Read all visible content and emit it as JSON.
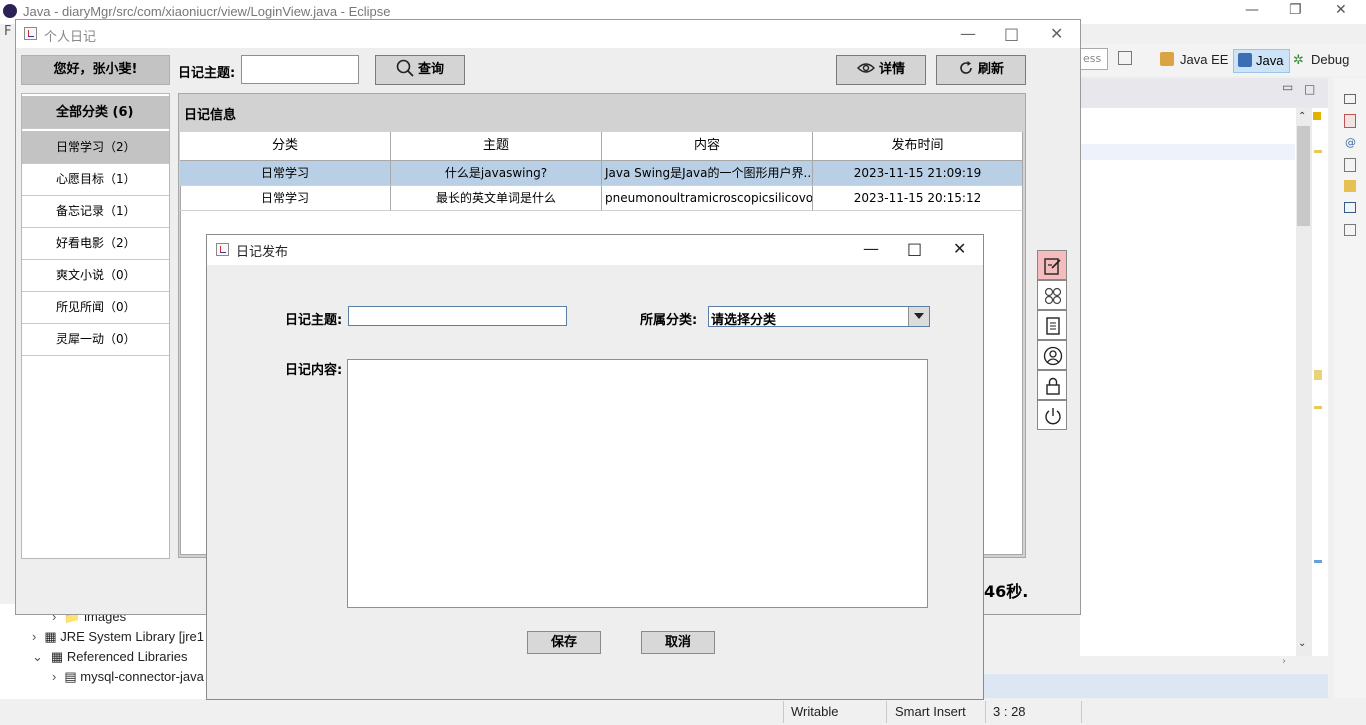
{
  "eclipse": {
    "title": "Java - diaryMgr/src/com/xiaoniucr/view/LoginView.java - Eclipse",
    "menu_partial": "F",
    "search_partial": "ess",
    "perspectives": [
      "Java EE",
      "Java",
      "Debug"
    ],
    "package_tree": [
      {
        "label": "images",
        "indent": 2
      },
      {
        "label": "JRE System Library [jre1",
        "indent": 1
      },
      {
        "label": "Referenced Libraries",
        "indent": 1
      },
      {
        "label": "mysql-connector-java",
        "indent": 2
      }
    ],
    "status": {
      "writable": "Writable",
      "insert_mode": "Smart Insert",
      "position": "3 : 28"
    }
  },
  "main_window": {
    "title": "个人日记",
    "greeting": "您好，张小斐!",
    "search_label": "日记主题:",
    "search_value": "",
    "query_button": "查询",
    "detail_button": "详情",
    "refresh_button": "刷新",
    "categories": [
      {
        "label": "全部分类 (6)",
        "selected": true
      },
      {
        "label": "日常学习（2）",
        "selected": true
      },
      {
        "label": "心愿目标（1）"
      },
      {
        "label": "备忘记录（1）"
      },
      {
        "label": "好看电影（2）"
      },
      {
        "label": "爽文小说（0）"
      },
      {
        "label": "所见所闻（0）"
      },
      {
        "label": "灵犀一动（0）"
      }
    ],
    "panel_title": "日记信息",
    "table": {
      "columns": [
        "分类",
        "主题",
        "内容",
        "发布时间"
      ],
      "rows": [
        [
          "日常学习",
          "什么是javaswing?",
          "Java Swing是Java的一个图形用户界...",
          "2023-11-15 21:09:19"
        ],
        [
          "日常学习",
          "最长的英文单词是什么",
          "pneumonoultramicroscopicsilicovol...",
          "2023-11-15 20:15:12"
        ]
      ]
    },
    "side_tools": [
      "edit-icon",
      "clover-icon",
      "document-icon",
      "user-icon",
      "lock-icon",
      "power-icon"
    ],
    "status_text_partial": "46秒."
  },
  "dialog": {
    "title": "日记发布",
    "subject_label": "日记主题:",
    "subject_value": "",
    "category_label": "所属分类:",
    "category_selected": "请选择分类",
    "content_label": "日记内容:",
    "content_value": "",
    "save_button": "保存",
    "cancel_button": "取消"
  },
  "colors": {
    "selection": "#b8cfe5",
    "panel_bg": "#d2d2d2",
    "active_tool": "#f4bcbc",
    "accent_red": "#c33"
  }
}
